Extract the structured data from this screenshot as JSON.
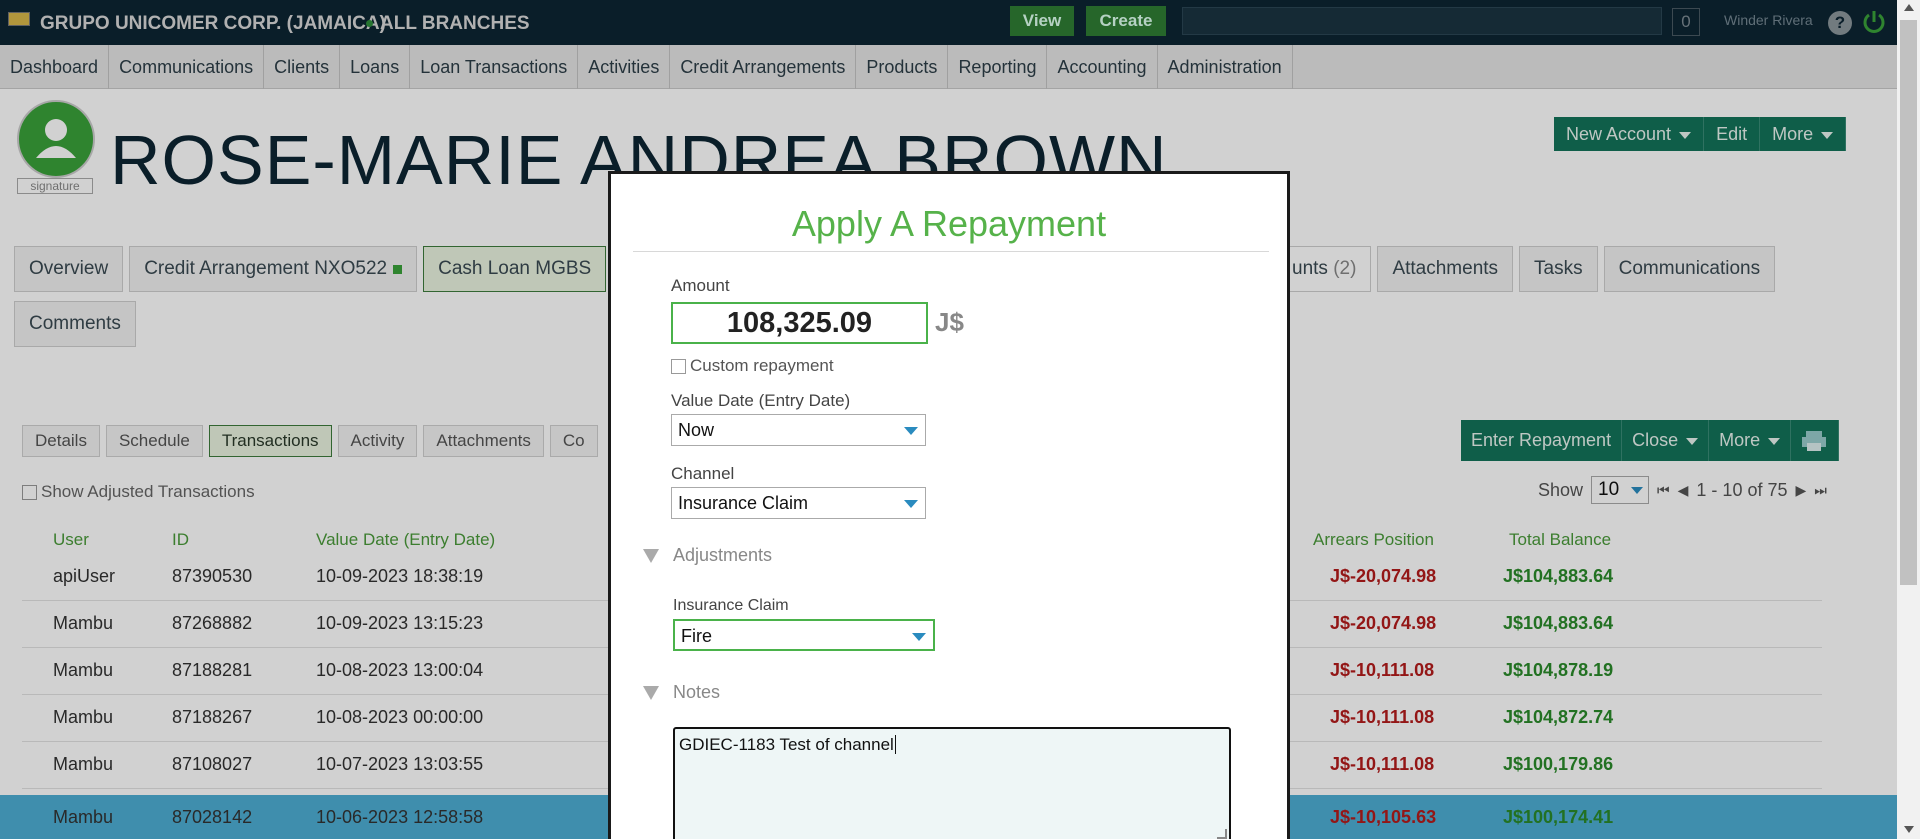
{
  "topbar": {
    "org": "GRUPO UNICOMER CORP. (JAMAICA)",
    "branch": "ALL BRANCHES",
    "view": "View",
    "create": "Create",
    "count": "0",
    "user": "Winder Rivera",
    "help": "?"
  },
  "nav": [
    "Dashboard",
    "Communications",
    "Clients",
    "Loans",
    "Loan Transactions",
    "Activities",
    "Credit Arrangements",
    "Products",
    "Reporting",
    "Accounting",
    "Administration"
  ],
  "client": {
    "name": "ROSE-MARIE ANDREA BROWN",
    "signature": "signature",
    "new_account": "New Account",
    "edit": "Edit",
    "more": "More"
  },
  "tabs": {
    "overview": "Overview",
    "credit": "Credit Arrangement NXO522",
    "cash": "Cash Loan MGBS",
    "accounts": "unts",
    "accounts_count": "(2)",
    "attachments": "Attachments",
    "tasks": "Tasks",
    "communications": "Communications",
    "comments": "Comments"
  },
  "subtabs": {
    "details": "Details",
    "schedule": "Schedule",
    "transactions": "Transactions",
    "activity": "Activity",
    "attachments": "Attachments",
    "co": "Co"
  },
  "txn_actions": {
    "enter": "Enter Repayment",
    "close": "Close",
    "more": "More"
  },
  "list": {
    "show_adjusted": "Show Adjusted Transactions",
    "show": "Show",
    "page_size": "10",
    "range": "1 - 10 of 75"
  },
  "columns": {
    "user": "User",
    "id": "ID",
    "value_date": "Value Date (Entry Date)",
    "arrears": "Arrears Position",
    "total": "Total Balance"
  },
  "rows": [
    {
      "user": "apiUser",
      "id": "87390530",
      "date": "10-09-2023 18:38:19",
      "arrears": "J$-20,074.98",
      "total": "J$104,883.64"
    },
    {
      "user": "Mambu",
      "id": "87268882",
      "date": "10-09-2023 13:15:23",
      "arrears": "J$-20,074.98",
      "total": "J$104,883.64"
    },
    {
      "user": "Mambu",
      "id": "87188281",
      "date": "10-08-2023 13:00:04",
      "arrears": "J$-10,111.08",
      "total": "J$104,878.19"
    },
    {
      "user": "Mambu",
      "id": "87188267",
      "date": "10-08-2023 00:00:00",
      "arrears": "J$-10,111.08",
      "total": "J$104,872.74"
    },
    {
      "user": "Mambu",
      "id": "87108027",
      "date": "10-07-2023 13:03:55",
      "arrears": "J$-10,111.08",
      "total": "J$100,179.86"
    },
    {
      "user": "Mambu",
      "id": "87028142",
      "date": "10-06-2023 12:58:58",
      "arrears": "J$-10,105.63",
      "total": "J$100,174.41"
    }
  ],
  "modal": {
    "title": "Apply A Repayment",
    "amount_label": "Amount",
    "amount": "108,325.09",
    "currency": "J$",
    "custom": "Custom repayment",
    "value_date_label": "Value Date (Entry Date)",
    "value_date": "Now",
    "channel_label": "Channel",
    "channel": "Insurance Claim",
    "adjustments": "Adjustments",
    "claim_label": "Insurance Claim",
    "claim": "Fire",
    "notes_label": "Notes",
    "notes": "GDIEC-1183 Test of channel"
  }
}
